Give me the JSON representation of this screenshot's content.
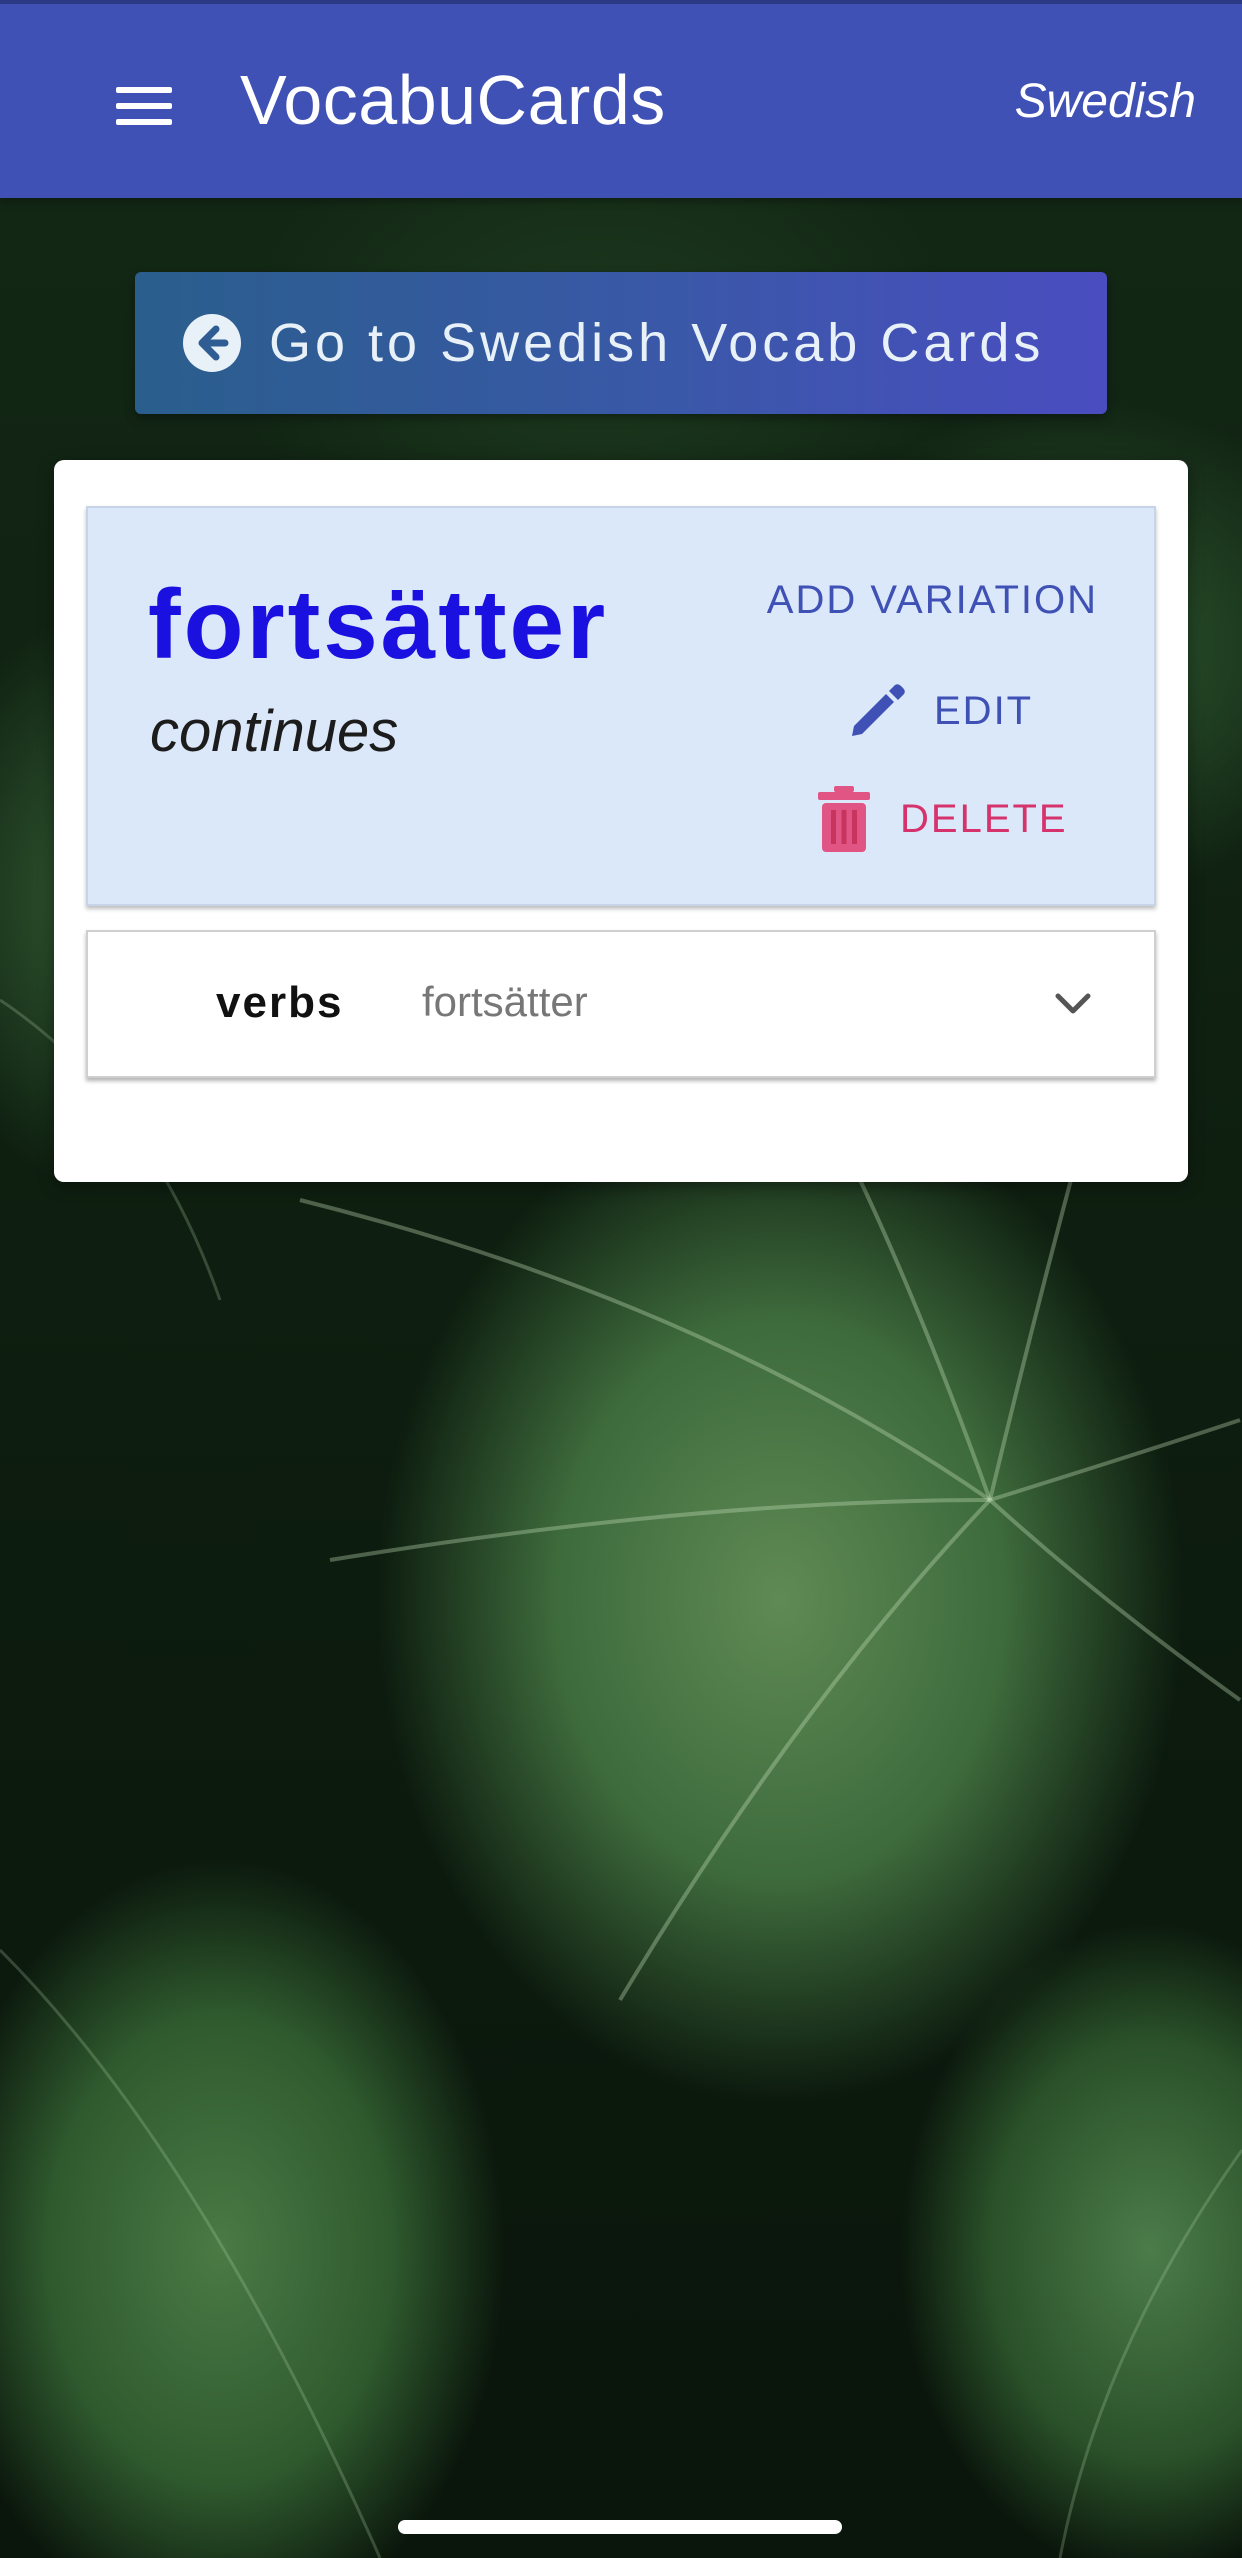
{
  "app": {
    "title": "VocabuCards",
    "language": "Swedish"
  },
  "navigation": {
    "back_button_label": "Go to Swedish Vocab Cards"
  },
  "word_card": {
    "term": "fortsätter",
    "translation": "continues",
    "actions": {
      "add_variation_label": "ADD VARIATION",
      "edit_label": "EDIT",
      "delete_label": "DELETE"
    }
  },
  "variations": [
    {
      "category": "verbs",
      "value": "fortsätter"
    }
  ],
  "colors": {
    "app_bar": "#3f51b5",
    "term": "#1a10e0",
    "delete": "#d6336c",
    "word_panel_bg": "#dbe8fa"
  },
  "icons": {
    "menu": "hamburger-menu-icon",
    "back": "arrow-circle-left-icon",
    "edit": "pencil-icon",
    "delete": "trash-icon",
    "expand": "chevron-down-icon"
  }
}
